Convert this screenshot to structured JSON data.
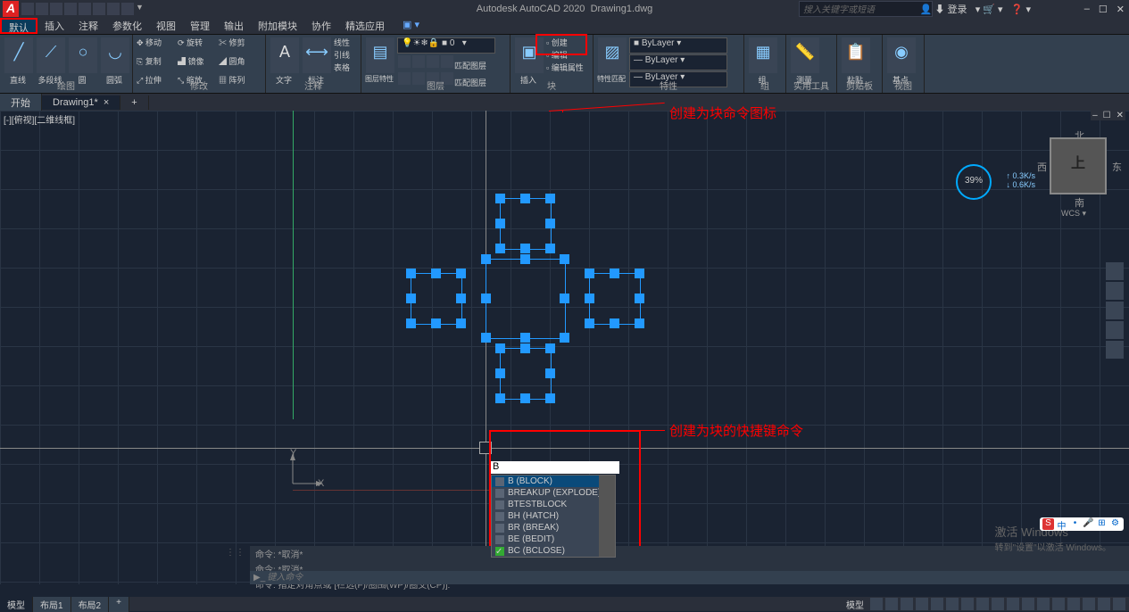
{
  "app": {
    "title_prefix": "Autodesk AutoCAD 2020",
    "filename": "Drawing1.dwg",
    "icon": "A"
  },
  "search_placeholder": "搜入关键字或短语",
  "login": "登录",
  "window_buttons": [
    "–",
    "☐",
    "✕"
  ],
  "inner_window_buttons": [
    "–",
    "☐",
    "✕"
  ],
  "menus": [
    "默认",
    "插入",
    "注释",
    "参数化",
    "视图",
    "管理",
    "输出",
    "附加模块",
    "协作",
    "精选应用"
  ],
  "ribbon": {
    "draw": {
      "title": "绘图",
      "items": [
        "直线",
        "多段线",
        "圆",
        "圆弧"
      ]
    },
    "modify": {
      "title": "修改",
      "items": [
        "移动",
        "复制",
        "拉伸",
        "旋转",
        "镜像",
        "缩放",
        "修剪",
        "圆角",
        "阵列"
      ]
    },
    "annotation": {
      "title": "注释",
      "text_label": "文字",
      "dim_label": "标注",
      "items": [
        "线性",
        "引线",
        "表格"
      ]
    },
    "layers": {
      "title": "图层",
      "props": "图层特性",
      "items": [
        "匹配图层"
      ]
    },
    "block": {
      "title": "块",
      "items": [
        "插入",
        "编辑属性",
        "创建",
        "编辑"
      ]
    },
    "properties": {
      "title": "特性",
      "match": "特性匹配",
      "layer_vals": [
        "ByLayer",
        "ByLayer",
        "ByLayer"
      ]
    },
    "group": {
      "title": "组",
      "label": "组"
    },
    "utils": {
      "title": "实用工具",
      "label": "测量"
    },
    "clipboard": {
      "title": "剪贴板",
      "label": "粘贴"
    },
    "view": {
      "title": "视图",
      "label": "基点"
    }
  },
  "doc_tabs": {
    "start": "开始",
    "drawing": "Drawing1*",
    "plus": "+"
  },
  "viewport": {
    "label": "[-][俯视][二维线框]",
    "wcs": "WCS"
  },
  "ucs": {
    "y": "Y",
    "x": "X"
  },
  "nav": {
    "n": "北",
    "s": "南",
    "e": "东",
    "w": "西",
    "top": "上"
  },
  "perf": {
    "val": "39%",
    "r1": "0.3K/s",
    "r2": "0.6K/s"
  },
  "annotations": {
    "a1": "创建为块命令图标",
    "a2": "创建为块的快捷键命令"
  },
  "command": {
    "typed": "B",
    "hist1": "命令: *取消*",
    "hist2": "命令: *取消*",
    "hist3": "命令: 指定对角点或 [栏选(F)/圈围(WP)/圈交(CP)]:",
    "placeholder": "键入命令"
  },
  "autocomplete": [
    {
      "t": "B (BLOCK)",
      "sel": true
    },
    {
      "t": "BREAKUP (EXPLODE)"
    },
    {
      "t": "BTESTBLOCK"
    },
    {
      "t": "BH (HATCH)"
    },
    {
      "t": "BR (BREAK)"
    },
    {
      "t": "BE (BEDIT)"
    },
    {
      "t": "BC (BCLOSE)"
    }
  ],
  "status": {
    "tabs": [
      "模型",
      "布局1",
      "布局2"
    ],
    "plus": "+",
    "model": "模型"
  },
  "watermark": {
    "l1": "激活 Windows",
    "l2": "转到\"设置\"以激活 Windows。"
  },
  "ime": [
    "S",
    "中",
    "•",
    "🎤",
    "⊞",
    "⚙"
  ]
}
